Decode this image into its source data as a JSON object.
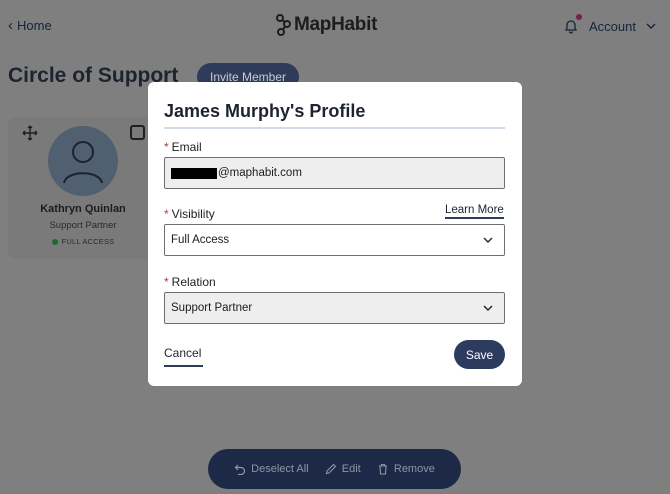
{
  "header": {
    "back_label": "Home",
    "logo_text": "MapHabit",
    "account_label": "Account"
  },
  "page": {
    "title": "Circle of Support",
    "invite_button": "Invite Member"
  },
  "member_card": {
    "name": "Kathryn Quinlan",
    "role": "Support Partner",
    "access": "FULL ACCESS"
  },
  "bottom_bar": {
    "deselect_all": "Deselect All",
    "edit": "Edit",
    "remove": "Remove"
  },
  "modal": {
    "title": "James Murphy's Profile",
    "email_label": "Email",
    "email_value_visible": "@maphabit.com",
    "visibility_label": "Visibility",
    "learn_more": "Learn More",
    "visibility_value": "Full Access",
    "relation_label": "Relation",
    "relation_value": "Support Partner",
    "cancel": "Cancel",
    "save": "Save",
    "required_marker": "*"
  },
  "colors": {
    "overlay_bg": "#7f7f7f",
    "primary_navy": "#2d3b5f",
    "bottom_bar": "#1c2a48",
    "required_red": "#c0392b",
    "status_green": "#1c6b2c"
  }
}
